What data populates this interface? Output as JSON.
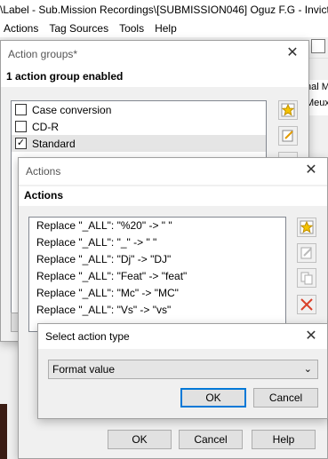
{
  "app": {
    "title": "\\Label - Sub.Mission Recordings\\[SUBMISSION046] Oguz F.G - Invicta",
    "menu": [
      "Actions",
      "Tag Sources",
      "Tools",
      "Help"
    ],
    "right_strip": [
      "nal M",
      "Meux"
    ]
  },
  "groups_window": {
    "title": "Action groups*",
    "header": "1 action group enabled",
    "items": [
      {
        "label": "Case conversion",
        "checked": false
      },
      {
        "label": "CD-R",
        "checked": false
      },
      {
        "label": "Standard",
        "checked": true
      }
    ]
  },
  "actions_window": {
    "title": "Actions",
    "header": "Actions",
    "items": [
      "Replace \"_ALL\": \"%20\" -> \" \"",
      "Replace \"_ALL\": \"_\" -> \" \"",
      "Replace \"_ALL\": \"Dj\" -> \"DJ\"",
      "Replace \"_ALL\": \"Feat\" -> \"feat\"",
      "Replace \"_ALL\": \"Mc\" -> \"MC\"",
      "Replace \"_ALL\": \"Vs\" -> \"vs\""
    ],
    "ok": "OK",
    "cancel": "Cancel",
    "help": "Help"
  },
  "select_dialog": {
    "title": "Select action type",
    "selected": "Format value",
    "ok": "OK",
    "cancel": "Cancel"
  },
  "colors": {
    "accent": "#0078d7",
    "star": "#f5c400",
    "delete": "#d9412a"
  }
}
